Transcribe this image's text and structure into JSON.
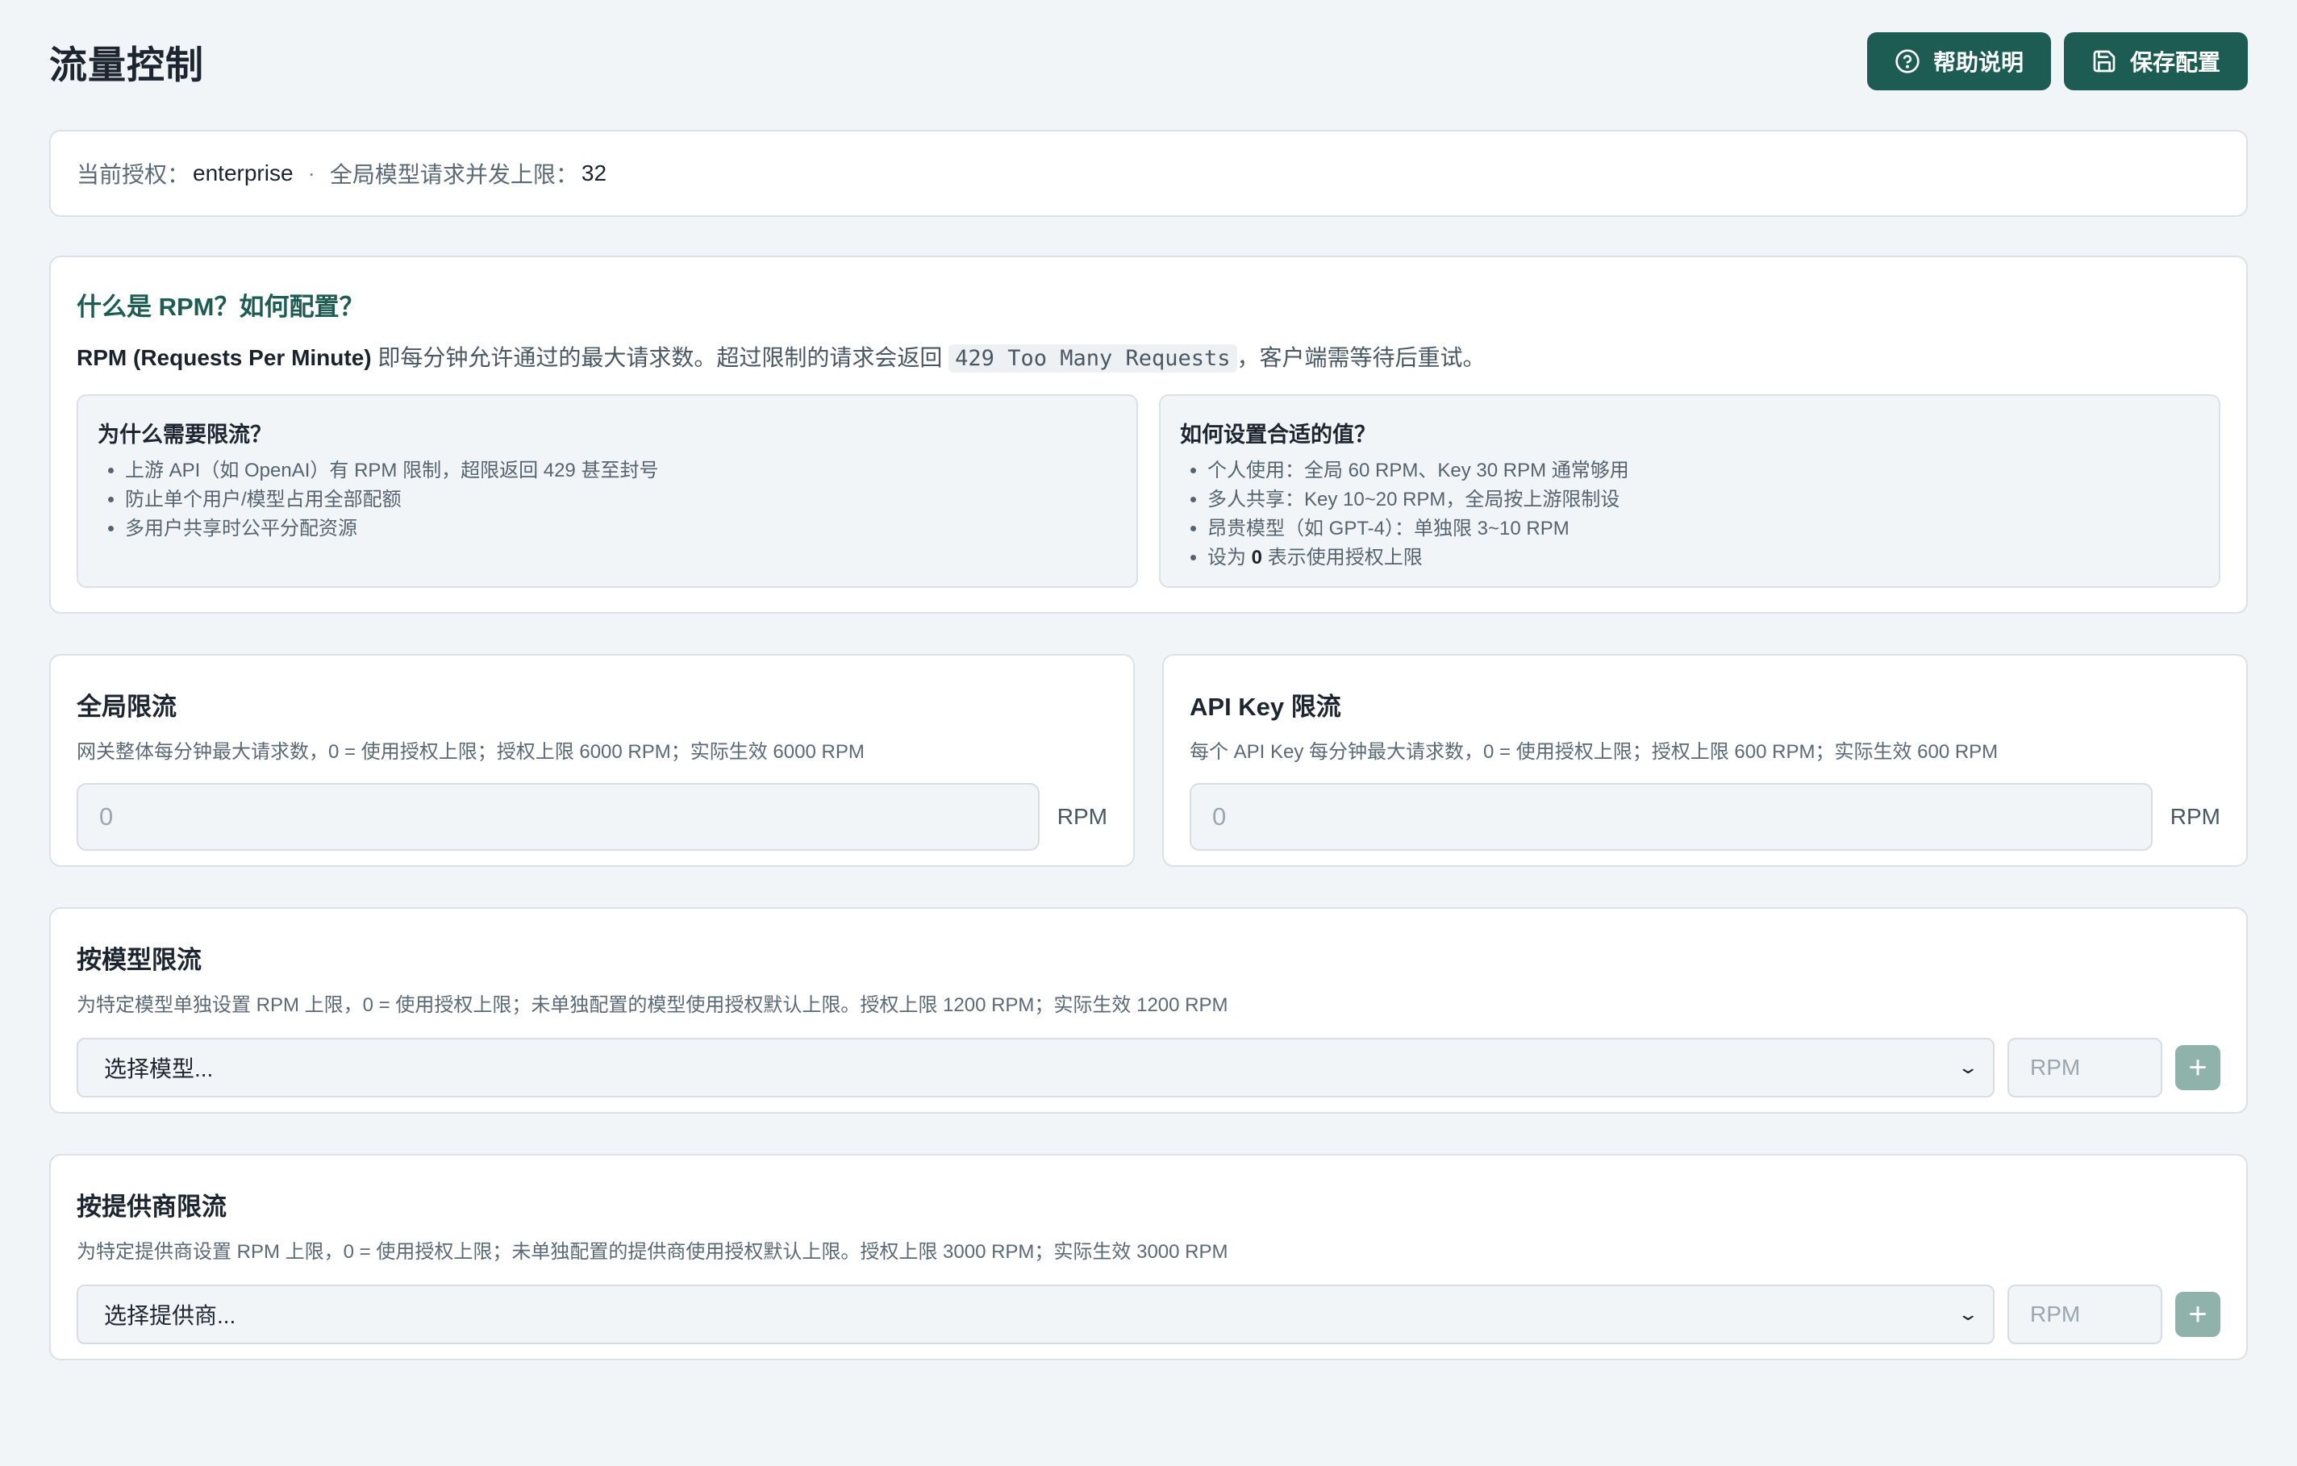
{
  "header": {
    "title": "流量控制",
    "help_button": "帮助说明",
    "save_button": "保存配置"
  },
  "license": {
    "current_label": "当前授权：",
    "current_value": "enterprise",
    "separator": "·",
    "concurrency_label": "全局模型请求并发上限：",
    "concurrency_value": "32"
  },
  "help": {
    "title": "什么是 RPM？如何配置？",
    "intro_bold": "RPM (Requests Per Minute)",
    "intro_text": " 即每分钟允许通过的最大请求数。超过限制的请求会返回 ",
    "intro_code": "429 Too Many Requests",
    "intro_tail": "，客户端需等待后重试。",
    "why": {
      "title": "为什么需要限流？",
      "items": [
        "上游 API（如 OpenAI）有 RPM 限制，超限返回 429 甚至封号",
        "防止单个用户/模型占用全部配额",
        "多用户共享时公平分配资源"
      ]
    },
    "how": {
      "title": "如何设置合适的值？",
      "items": [
        "个人使用：全局 60 RPM、Key 30 RPM 通常够用",
        "多人共享：Key 10~20 RPM，全局按上游限制设",
        "昂贵模型（如 GPT-4）：单独限 3~10 RPM"
      ],
      "last_prefix": "设为 ",
      "last_bold": "0",
      "last_suffix": " 表示使用授权上限"
    }
  },
  "global_limit": {
    "title": "全局限流",
    "desc": "网关整体每分钟最大请求数，0 = 使用授权上限；授权上限 6000 RPM；实际生效 6000 RPM",
    "value": "0",
    "unit": "RPM"
  },
  "key_limit": {
    "title": "API Key 限流",
    "desc": "每个 API Key 每分钟最大请求数，0 = 使用授权上限；授权上限 600 RPM；实际生效 600 RPM",
    "value": "0",
    "unit": "RPM"
  },
  "model_limit": {
    "title": "按模型限流",
    "desc": "为特定模型单独设置 RPM 上限，0 = 使用授权上限；未单独配置的模型使用授权默认上限。授权上限 1200 RPM；实际生效 1200 RPM",
    "select_placeholder": "选择模型...",
    "rpm_placeholder": "RPM",
    "add_label": "+"
  },
  "provider_limit": {
    "title": "按提供商限流",
    "desc": "为特定提供商设置 RPM 上限，0 = 使用授权上限；未单独配置的提供商使用授权默认上限。授权上限 3000 RPM；实际生效 3000 RPM",
    "select_placeholder": "选择提供商...",
    "rpm_placeholder": "RPM",
    "add_label": "+"
  },
  "icons": {
    "help": "question-circle-icon",
    "save": "floppy-disk-icon",
    "chevron": "chevron-down-icon"
  },
  "colors": {
    "primary": "#1c5c52",
    "add_button": "#8fb3ab",
    "background": "#f2f5f7"
  }
}
